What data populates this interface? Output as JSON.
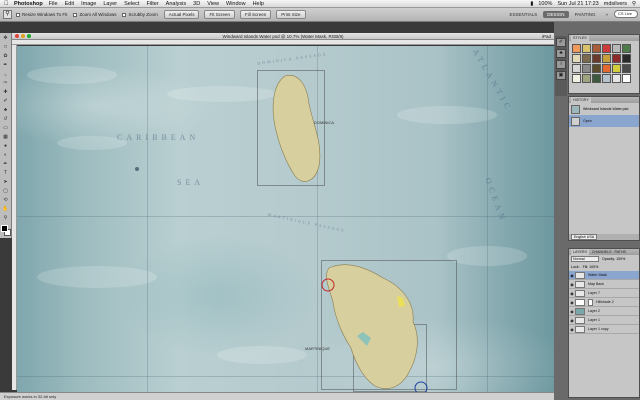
{
  "menubar": {
    "app": "Photoshop",
    "items": [
      "File",
      "Edit",
      "Image",
      "Layer",
      "Select",
      "Filter",
      "Analysis",
      "3D",
      "View",
      "Window",
      "Help"
    ],
    "status": {
      "battery": "100%",
      "clock": "Sun Jul 21 17:23",
      "user": "mdsilvers"
    }
  },
  "options": {
    "resize_windows": "Resize Windows To Fit",
    "zoom_all": "Zoom All Windows",
    "scrubby_zoom": "Scrubby Zoom",
    "actual_pixels": "Actual Pixels",
    "fit_screen": "Fit Screen",
    "fill_screen": "Fill Screen",
    "print_size": "Print Size",
    "workspaces": [
      "ESSENTIALS",
      "DESIGN",
      "PAINTING"
    ],
    "more": "»",
    "search": "CS Live"
  },
  "document": {
    "title": "Windward Islands Water psd @ 10.7% (Water Mask, RGB/8)",
    "mode_label": "iPad",
    "labels": {
      "caribbean": "CARIBBEAN",
      "sea": "SEA",
      "dominica": "DOMINICA",
      "martinique": "MARTINIQUE",
      "passage": "MARTINIQUE PASSAGE",
      "atlantic": "ATLANTIC",
      "ocean": "OCEAN",
      "dominica_passage": "DOMINICA PASSAGE"
    }
  },
  "statusbar": {
    "text": "Exposure works in 32-bit only"
  },
  "panels": {
    "swatches_tab": "STYLES",
    "history_tab": "HISTORY",
    "history_items": [
      {
        "label": "Windward Islands Water.psd"
      },
      {
        "label": "Open"
      }
    ],
    "layers_tabs": [
      "LAYERS",
      "CHANNELS",
      "PATHS"
    ],
    "blend_mode": "Normal",
    "opacity": "Opacity: 100%",
    "lock": "Lock:",
    "fill": "Fill: 100%",
    "lang_value": "English USA",
    "layers": [
      {
        "name": "Water Mask",
        "selected": true
      },
      {
        "name": "Map Back",
        "selected": false
      },
      {
        "name": "Layer 7",
        "selected": false
      },
      {
        "name": "Hillshade 2",
        "selected": false
      },
      {
        "name": "Layer 2",
        "selected": false
      },
      {
        "name": "Layer 1",
        "selected": false
      },
      {
        "name": "Layer 1 copy",
        "selected": false
      }
    ]
  },
  "colors": {
    "swatches": [
      "#f29a5b",
      "#d9c06a",
      "#a85e3a",
      "#ce3b3b",
      "#b8b8b8",
      "#4f7a4a",
      "#e2d9b8",
      "#7b6a4d",
      "#6b3a2c",
      "#c7a03b",
      "#8e2a2a",
      "#2a2a2a",
      "#d6d6d6",
      "#8a8a8a",
      "#5a4b2d",
      "#e26a2e",
      "#d3cc3b",
      "#4a4a4a",
      "#f2efe3",
      "#9fa37e",
      "#3e5a3e",
      "#b5c2cc",
      "#e6e6e6",
      "#ffffff"
    ]
  }
}
